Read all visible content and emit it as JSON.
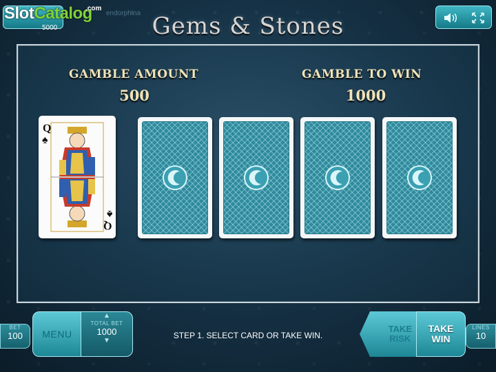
{
  "header": {
    "watermark_part1": "Slot",
    "watermark_part2": "Catalog",
    "watermark_com": ".com",
    "credit_value": "5000",
    "provider": "endorphina",
    "game_title": "Gems & Stones",
    "sound_icon": "speaker-icon",
    "fullscreen_icon": "fullscreen-icon"
  },
  "gamble": {
    "amount_label": "GAMBLE AMOUNT",
    "amount_value": "500",
    "win_label": "GAMBLE TO WIN",
    "win_value": "1000",
    "dealer_card": {
      "rank": "Q",
      "suit": "♠"
    },
    "face_down_cards": 4
  },
  "footer": {
    "bet_label": "BET",
    "bet_value": "100",
    "menu_label": "MENU",
    "total_bet_label": "TOTAL BET",
    "total_bet_value": "1000",
    "status_text": "STEP 1. SELECT CARD OR TAKE WIN.",
    "take_risk_label_1": "TAKE",
    "take_risk_label_2": "RISK",
    "take_win_label_1": "TAKE",
    "take_win_label_2": "WIN",
    "lines_label": "LINES",
    "lines_value": "10"
  },
  "colors": {
    "accent": "#2f8a9c",
    "gold_text": "#f1e3b8"
  }
}
